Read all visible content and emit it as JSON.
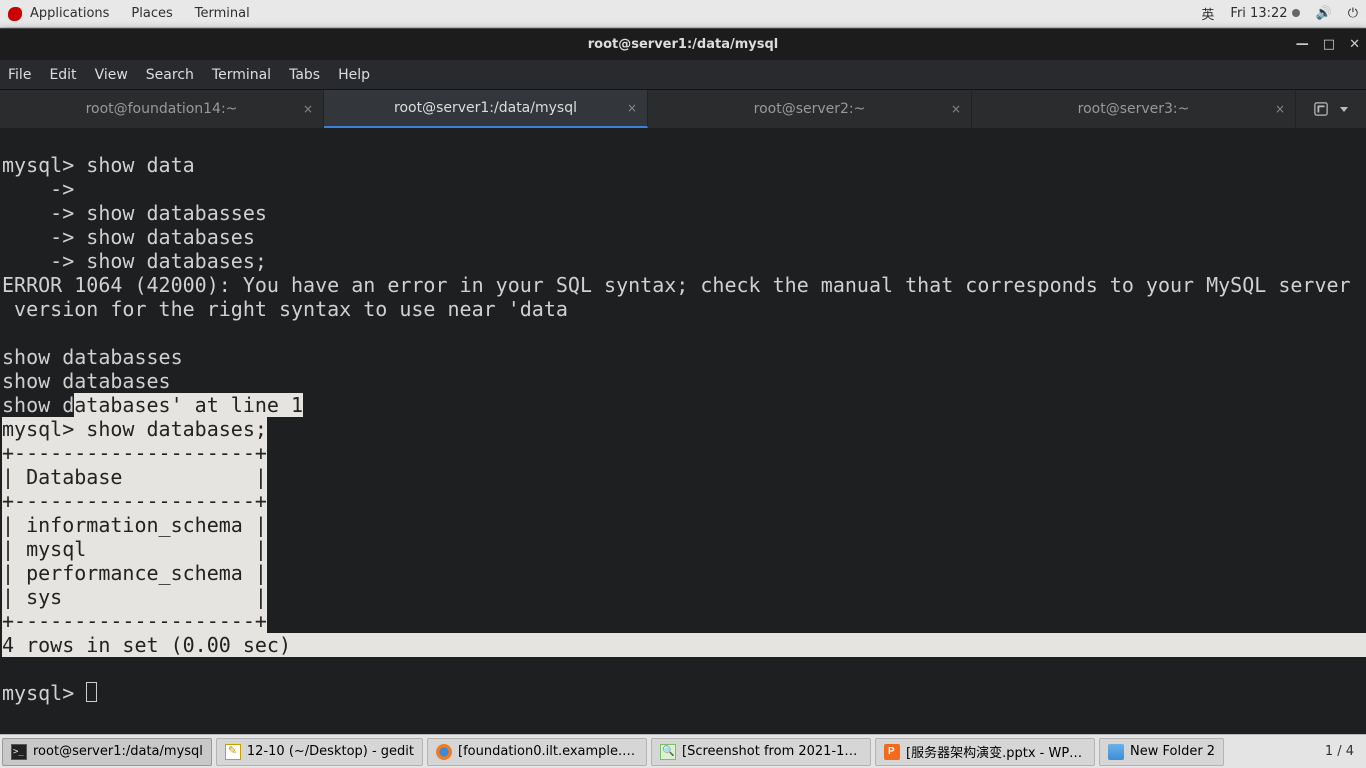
{
  "topbar": {
    "menus": [
      "Applications",
      "Places",
      "Terminal"
    ],
    "ime": "英",
    "clock": "Fri 13:22"
  },
  "window": {
    "title": "root@server1:/data/mysql"
  },
  "menubar": [
    "File",
    "Edit",
    "View",
    "Search",
    "Terminal",
    "Tabs",
    "Help"
  ],
  "tabs": [
    {
      "label": "root@foundation14:~",
      "active": false
    },
    {
      "label": "root@server1:/data/mysql",
      "active": true
    },
    {
      "label": "root@server2:~",
      "active": false
    },
    {
      "label": "root@server3:~",
      "active": false
    }
  ],
  "terminal": {
    "plain1": "mysql> show data\n    -> \n    -> show databasses\n    -> show databases\n    -> show databases;\nERROR 1064 (42000): You have an error in your SQL syntax; check the manual that corresponds to your MySQL server\n version for the right syntax to use near 'data\n\nshow databasses\nshow databases\nshow d",
    "selected": "atabases' at line 1\nmysql> show databases;\n+--------------------+\n| Database           |\n+--------------------+\n| information_schema |\n| mysql              |\n| performance_schema |\n| sys                |\n+--------------------+\n4 rows in set (0.00 sec)",
    "selpad": "                                                                                               ",
    "plain2": "\n\nmysql> "
  },
  "taskbar": {
    "items": [
      {
        "label": "root@server1:/data/mysql",
        "icon": "ico-term",
        "active": true
      },
      {
        "label": "12-10 (~/Desktop) - gedit",
        "icon": "ico-gedit"
      },
      {
        "label": "[foundation0.ilt.example.co…",
        "icon": "ico-ff"
      },
      {
        "label": "[Screenshot from 2021-12-…",
        "icon": "ico-img"
      },
      {
        "label": "[服务器架构演变.pptx - WPS…",
        "icon": "ico-wps"
      },
      {
        "label": "New Folder 2",
        "icon": "ico-folder"
      }
    ],
    "workspace": "1 / 4"
  }
}
